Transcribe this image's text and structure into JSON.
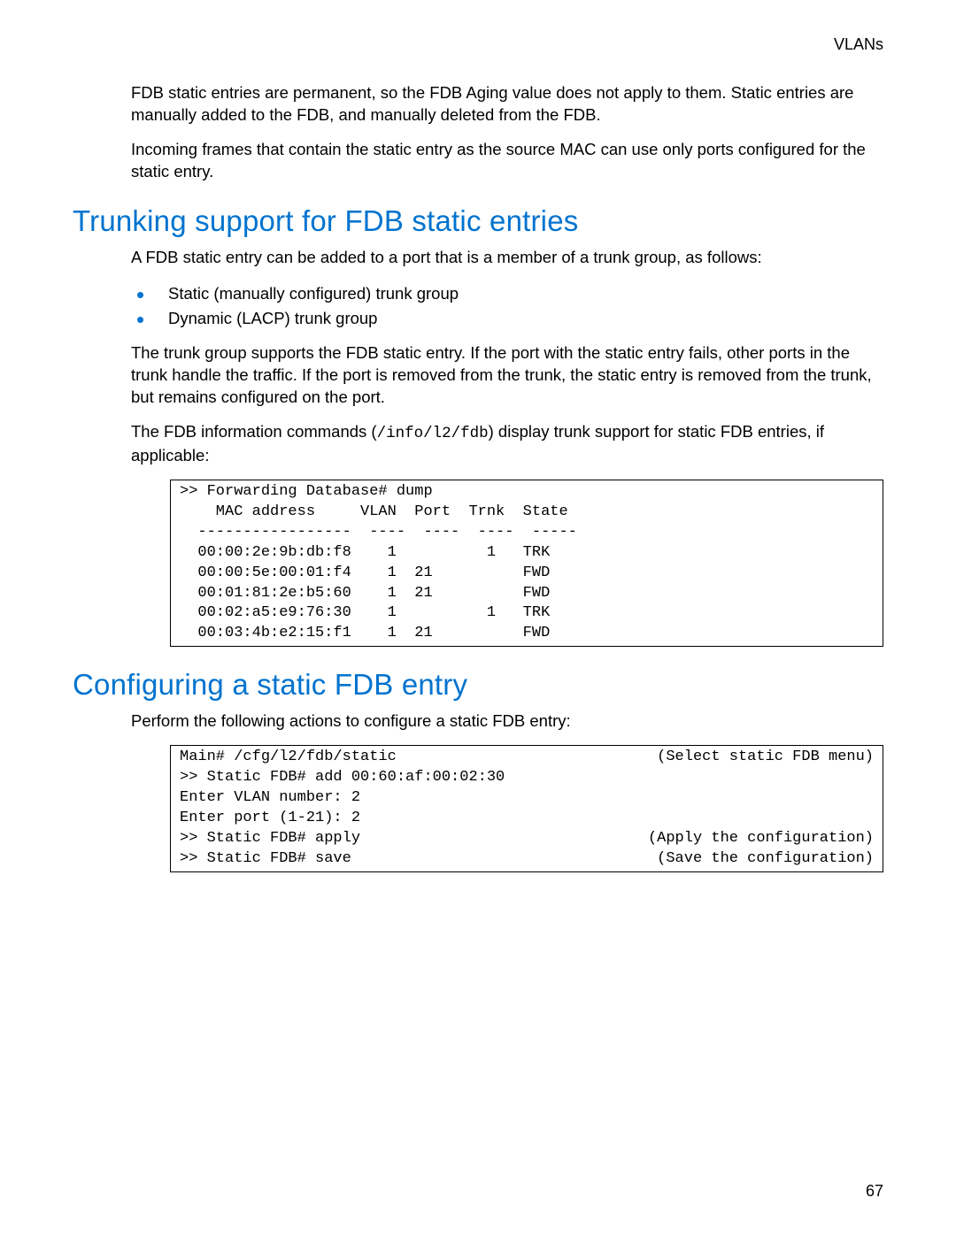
{
  "header": {
    "section_label": "VLANs"
  },
  "intro": {
    "p1": "FDB static entries are permanent, so the FDB Aging value does not apply to them. Static entries are manually added to the FDB, and manually deleted from the FDB.",
    "p2": "Incoming frames that contain the static entry as the source MAC can use only ports configured for the static entry."
  },
  "section1": {
    "title": "Trunking support for FDB static entries",
    "p1": "A FDB static entry can be added to a port that is a member of a trunk group, as follows:",
    "bullets": [
      "Static (manually configured) trunk group",
      "Dynamic (LACP) trunk group"
    ],
    "p2": "The trunk group supports the FDB static entry. If the port with the static entry fails, other ports in the trunk handle the traffic. If the port is removed from the trunk, the static entry is removed from the trunk, but remains configured on the port.",
    "p3_pre": "The FDB information commands (",
    "p3_code": "/info/l2/fdb",
    "p3_post": ") display trunk support for static FDB entries, if applicable:"
  },
  "chart_data": {
    "type": "table",
    "title": ">> Forwarding Database# dump",
    "columns": [
      "MAC address",
      "VLAN",
      "Port",
      "Trnk",
      "State"
    ],
    "rows": [
      {
        "mac": "00:00:2e:9b:db:f8",
        "vlan": 1,
        "port": "",
        "trnk": 1,
        "state": "TRK"
      },
      {
        "mac": "00:00:5e:00:01:f4",
        "vlan": 1,
        "port": 21,
        "trnk": "",
        "state": "FWD"
      },
      {
        "mac": "00:01:81:2e:b5:60",
        "vlan": 1,
        "port": 21,
        "trnk": "",
        "state": "FWD"
      },
      {
        "mac": "00:02:a5:e9:76:30",
        "vlan": 1,
        "port": "",
        "trnk": 1,
        "state": "TRK"
      },
      {
        "mac": "00:03:4b:e2:15:f1",
        "vlan": 1,
        "port": 21,
        "trnk": "",
        "state": "FWD"
      }
    ]
  },
  "codebox1": {
    "line1": ">> Forwarding Database# dump",
    "line2": "    MAC address     VLAN  Port  Trnk  State",
    "line3": "  -----------------  ----  ----  ----  -----",
    "line4": "  00:00:2e:9b:db:f8    1          1   TRK",
    "line5": "  00:00:5e:00:01:f4    1  21          FWD",
    "line6": "  00:01:81:2e:b5:60    1  21          FWD",
    "line7": "  00:02:a5:e9:76:30    1          1   TRK",
    "line8": "  00:03:4b:e2:15:f1    1  21          FWD"
  },
  "section2": {
    "title": "Configuring a static FDB entry",
    "p1": "Perform the following actions to configure a static FDB entry:"
  },
  "codebox2": {
    "rows": [
      {
        "left": "Main# /cfg/l2/fdb/static",
        "right": "(Select static FDB menu)"
      },
      {
        "left": ">> Static FDB# add 00:60:af:00:02:30",
        "right": ""
      },
      {
        "left": "Enter VLAN number: 2",
        "right": ""
      },
      {
        "left": "Enter port (1-21): 2",
        "right": ""
      },
      {
        "left": ">> Static FDB# apply",
        "right": "(Apply the configuration)"
      },
      {
        "left": ">> Static FDB# save",
        "right": "(Save the configuration)"
      }
    ]
  },
  "footer": {
    "page_number": "67"
  }
}
